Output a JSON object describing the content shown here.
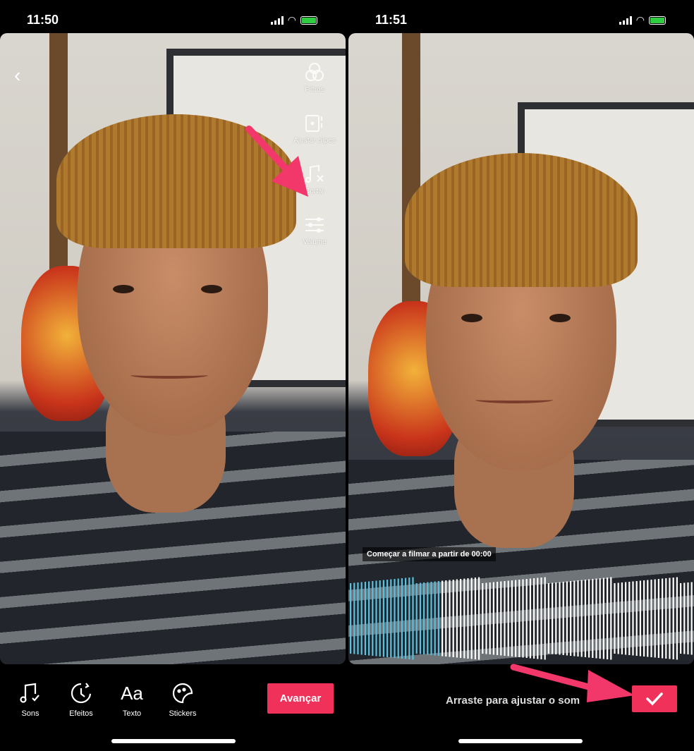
{
  "left": {
    "status": {
      "time": "11:50"
    },
    "side_tools": [
      {
        "label": "Filtros",
        "icon": "filters-icon"
      },
      {
        "label": "Ajustar clipes",
        "icon": "adjust-clips-icon"
      },
      {
        "label": "Cortar",
        "icon": "cut-sound-icon"
      },
      {
        "label": "Volume",
        "icon": "volume-sliders-icon"
      }
    ],
    "toolbar": [
      {
        "label": "Sons",
        "icon": "music-note-check-icon"
      },
      {
        "label": "Efeitos",
        "icon": "effects-timer-icon"
      },
      {
        "label": "Texto",
        "glyph": "Aa"
      },
      {
        "label": "Stickers",
        "icon": "sticker-icon"
      }
    ],
    "next_label": "Avançar"
  },
  "right": {
    "status": {
      "time": "11:51"
    },
    "tooltip": "Começar a filmar a partir de 00:00",
    "hint": "Arraste para ajustar o som",
    "confirm_icon": "checkmark-icon"
  },
  "colors": {
    "accent": "#f0325a",
    "waveform_selected": "#5bc0de",
    "waveform": "#ffffff",
    "annotation_arrow": "#f2386a"
  }
}
